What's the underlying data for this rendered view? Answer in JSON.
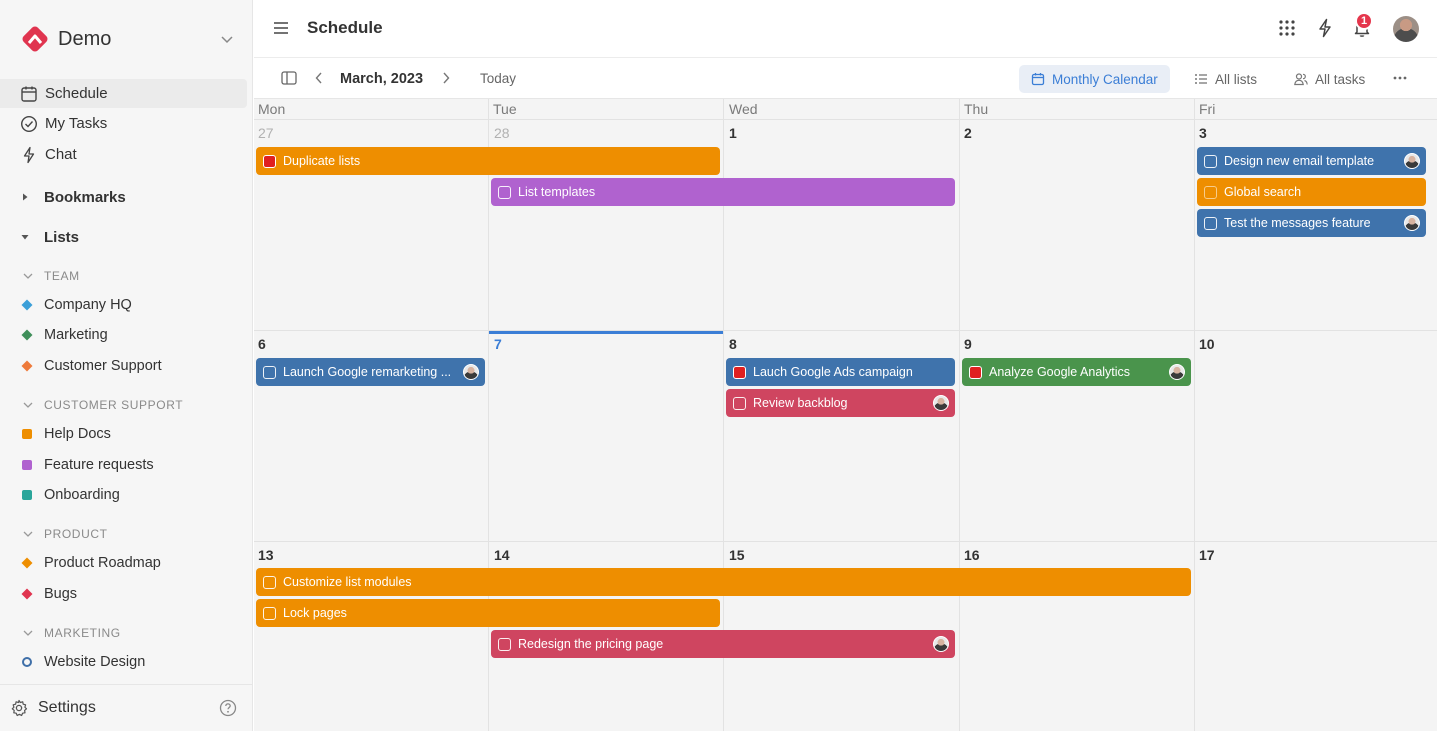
{
  "workspace": {
    "name": "Demo"
  },
  "nav": [
    {
      "label": "Schedule",
      "icon": "calendar-icon",
      "active": true
    },
    {
      "label": "My Tasks",
      "icon": "check-circle-icon",
      "active": false
    },
    {
      "label": "Chat",
      "icon": "bolt-icon",
      "active": false
    }
  ],
  "sections": {
    "bookmarks": "Bookmarks",
    "lists": "Lists"
  },
  "groups": [
    {
      "title": "TEAM",
      "items": [
        {
          "label": "Company HQ",
          "color": "#3b9fd8",
          "shape": "diamond"
        },
        {
          "label": "Marketing",
          "color": "#3f8f5a",
          "shape": "diamond"
        },
        {
          "label": "Customer Support",
          "color": "#ee7a3a",
          "shape": "diamond"
        }
      ]
    },
    {
      "title": "CUSTOMER SUPPORT",
      "items": [
        {
          "label": "Help Docs",
          "color": "#ee8e00",
          "shape": "square"
        },
        {
          "label": "Feature requests",
          "color": "#b062cf",
          "shape": "square"
        },
        {
          "label": "Onboarding",
          "color": "#2aa59a",
          "shape": "square"
        }
      ]
    },
    {
      "title": "PRODUCT",
      "items": [
        {
          "label": "Product Roadmap",
          "color": "#ee8e00",
          "shape": "diamond"
        },
        {
          "label": "Bugs",
          "color": "#e0344f",
          "shape": "diamond"
        }
      ]
    },
    {
      "title": "MARKETING",
      "items": [
        {
          "label": "Website Design",
          "color": "#3f6fa8",
          "shape": "ring"
        }
      ]
    }
  ],
  "footer": {
    "settings": "Settings"
  },
  "header": {
    "title": "Schedule",
    "notifications": "1"
  },
  "toolbar": {
    "month": "March, 2023",
    "today": "Today",
    "views": [
      {
        "label": "Monthly Calendar",
        "icon": "calendar-icon",
        "active": true
      },
      {
        "label": "All lists",
        "icon": "list-icon",
        "active": false
      },
      {
        "label": "All tasks",
        "icon": "users-icon",
        "active": false
      }
    ]
  },
  "calendar": {
    "weekdays": [
      "Mon",
      "Tue",
      "Wed",
      "Thu",
      "Fri"
    ],
    "weeks": [
      {
        "days": [
          {
            "num": "27",
            "muted": true
          },
          {
            "num": "28",
            "muted": true
          },
          {
            "num": "1"
          },
          {
            "num": "2"
          },
          {
            "num": "3"
          }
        ]
      },
      {
        "days": [
          {
            "num": "6"
          },
          {
            "num": "7",
            "today": true
          },
          {
            "num": "8"
          },
          {
            "num": "9"
          },
          {
            "num": "10"
          }
        ]
      },
      {
        "days": [
          {
            "num": "13"
          },
          {
            "num": "14"
          },
          {
            "num": "15"
          },
          {
            "num": "16"
          },
          {
            "num": "17"
          }
        ]
      }
    ],
    "colors": {
      "orange": "#ee8e00",
      "purple": "#b062cf",
      "blue": "#3f73ac",
      "pink": "#cf4560",
      "green": "#4a944c",
      "today": "#3b7ed6"
    },
    "tasks": [
      {
        "label": "Duplicate lists",
        "week": 0,
        "start": 0,
        "span": 2,
        "row": 0,
        "color": "orange",
        "checkbox": "red",
        "avatar": false
      },
      {
        "label": "List templates",
        "week": 0,
        "start": 1,
        "span": 2,
        "row": 1,
        "color": "purple",
        "checkbox": "empty",
        "avatar": false
      },
      {
        "label": "Design new email template",
        "week": 0,
        "start": 4,
        "span": 1,
        "row": 0,
        "color": "blue",
        "checkbox": "empty",
        "avatar": true
      },
      {
        "label": "Global search",
        "week": 0,
        "start": 4,
        "span": 1,
        "row": 1,
        "color": "orange",
        "checkbox": "orange",
        "avatar": false
      },
      {
        "label": "Test the messages feature",
        "week": 0,
        "start": 4,
        "span": 1,
        "row": 2,
        "color": "blue",
        "checkbox": "empty",
        "avatar": true
      },
      {
        "label": "Launch Google remarketing ...",
        "week": 1,
        "start": 0,
        "span": 1,
        "row": 0,
        "color": "blue",
        "checkbox": "empty",
        "avatar": true
      },
      {
        "label": "Lauch Google Ads campaign",
        "week": 1,
        "start": 2,
        "span": 1,
        "row": 0,
        "color": "blue",
        "checkbox": "red",
        "avatar": false
      },
      {
        "label": "Review backblog",
        "week": 1,
        "start": 2,
        "span": 1,
        "row": 1,
        "color": "pink",
        "checkbox": "empty",
        "avatar": true
      },
      {
        "label": "Analyze Google Analytics",
        "week": 1,
        "start": 3,
        "span": 1,
        "row": 0,
        "color": "green",
        "checkbox": "red",
        "avatar": true
      },
      {
        "label": "Customize list modules",
        "week": 2,
        "start": 0,
        "span": 4,
        "row": 0,
        "color": "orange",
        "checkbox": "empty",
        "avatar": false
      },
      {
        "label": "Lock pages",
        "week": 2,
        "start": 0,
        "span": 2,
        "row": 1,
        "color": "orange",
        "checkbox": "empty",
        "avatar": false
      },
      {
        "label": "Redesign the pricing page",
        "week": 2,
        "start": 1,
        "span": 2,
        "row": 2,
        "color": "pink",
        "checkbox": "empty",
        "avatar": true
      }
    ]
  }
}
